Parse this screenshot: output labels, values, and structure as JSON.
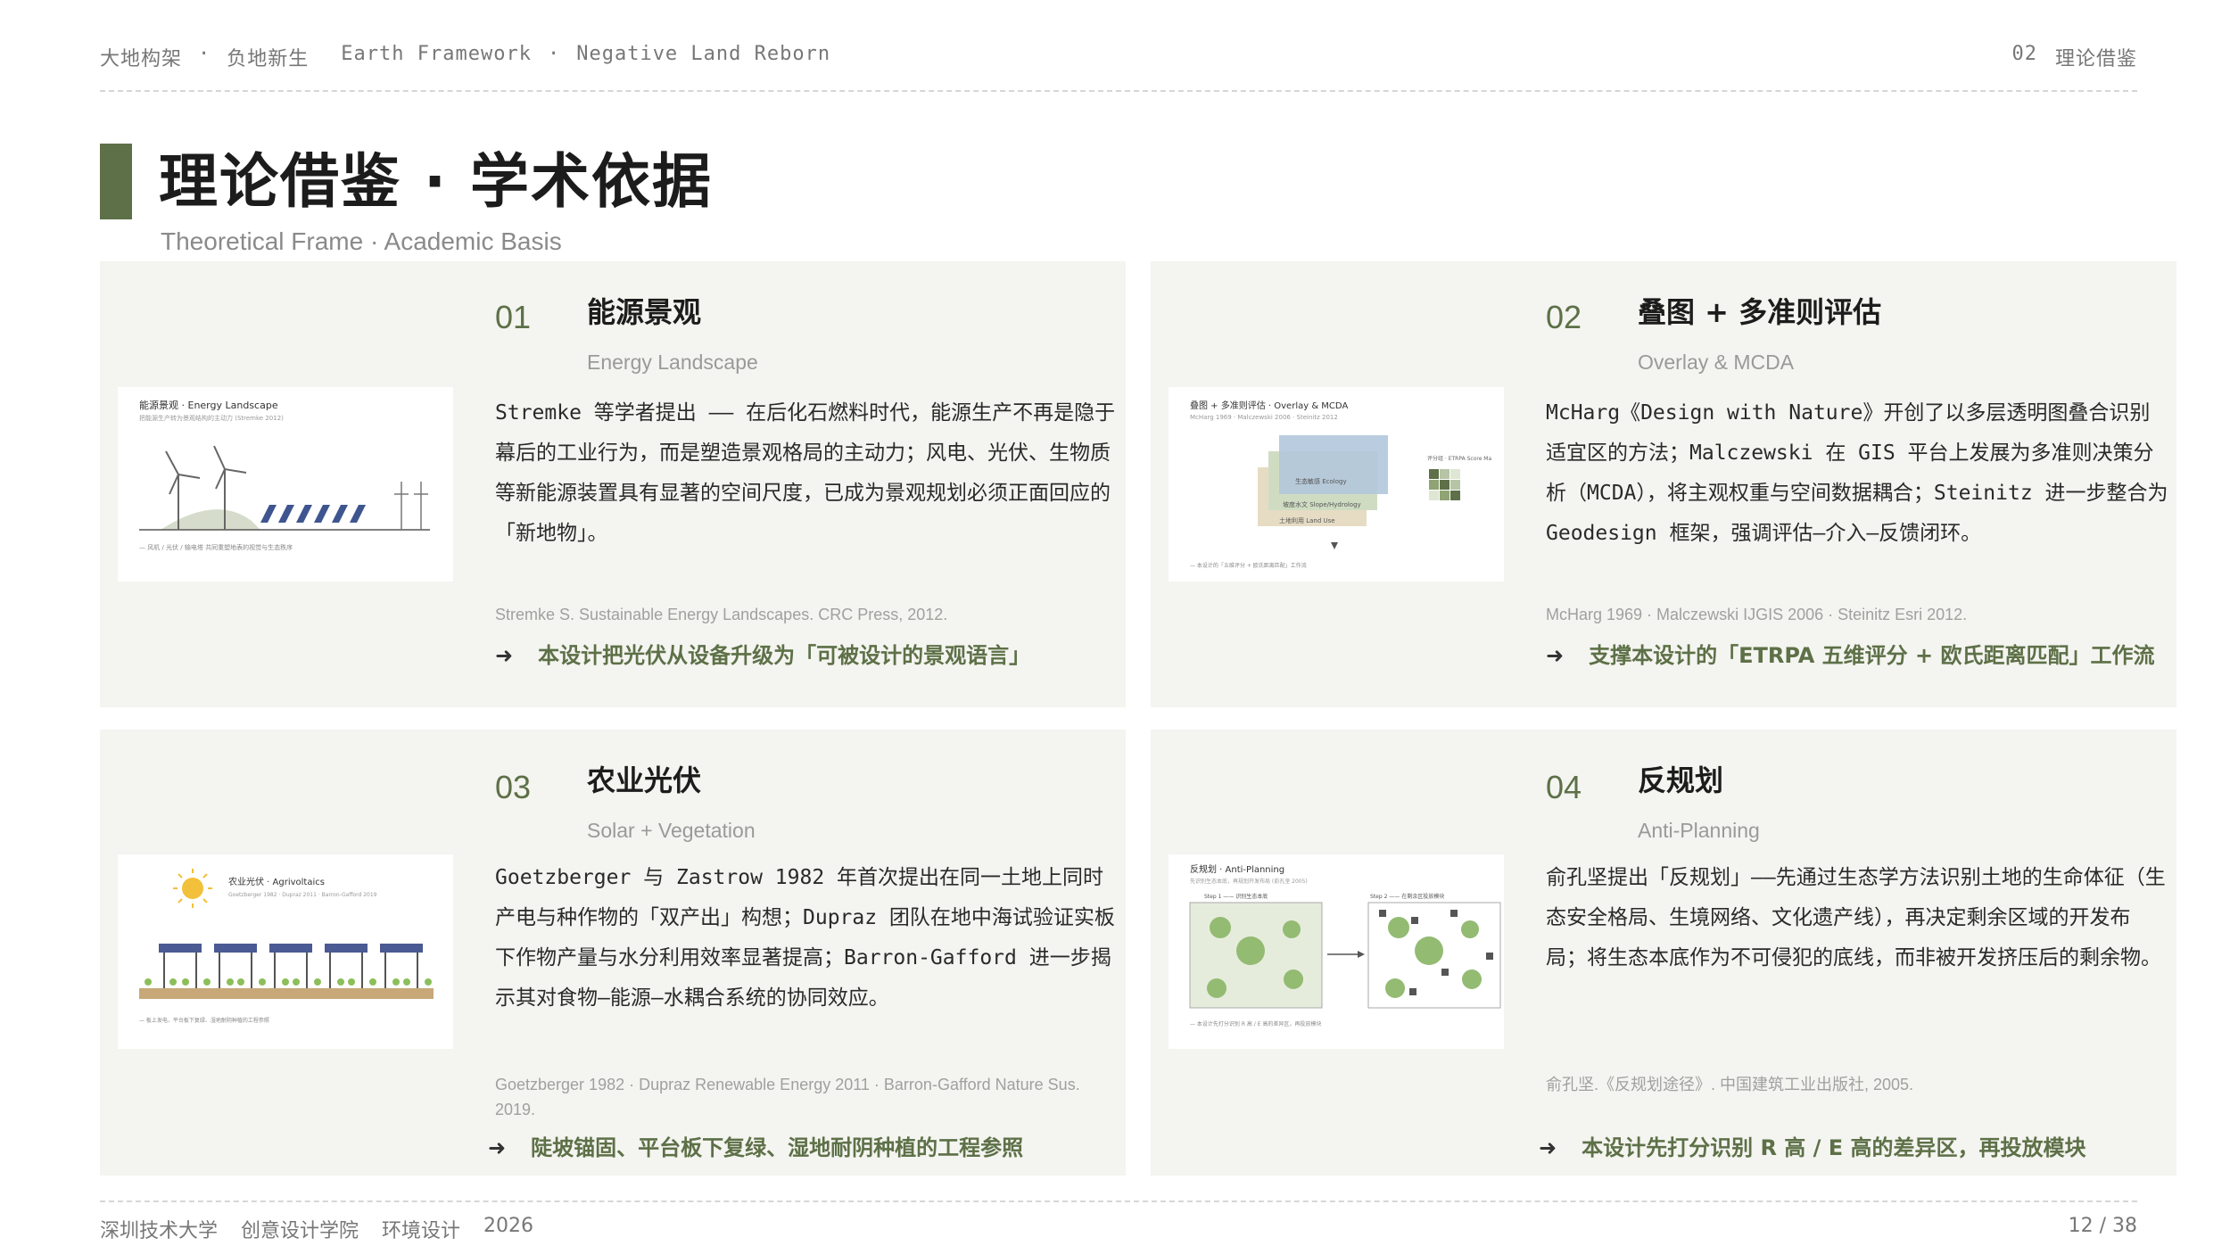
{
  "header": {
    "left_items": [
      "大地构架",
      "·",
      "负地新生",
      "Earth Framework",
      "·",
      "Negative Land Reborn"
    ],
    "section_num": "02",
    "section_name": "理论借鉴"
  },
  "page": {
    "title": "理论借鉴 · 学术依据",
    "subtitle": "Theoretical Frame · Academic Basis"
  },
  "accent_color": "#5d7047",
  "cards": [
    {
      "num": "01",
      "title": "能源景观",
      "subtitle": "Energy Landscape",
      "body": "Stremke 等学者提出 —— 在后化石燃料时代，能源生产不再是隐于幕后的工业行为，而是塑造景观格局的主动力；风电、光伏、生物质等新能源装置具有显著的空间尺度，已成为景观规划必须正面回应的「新地物」。",
      "ref": "Stremke S. Sustainable Energy Landscapes. CRC Press, 2012.",
      "takeaway": "本设计把光伏从设备升级为「可被设计的景观语言」",
      "thumb": {
        "title": "能源景观 · Energy Landscape",
        "note": "把能源生产转为景观结构的主动力 (Stremke 2012)",
        "caption": "— 风机 / 光伏 / 输电塔 共同重塑地表的视觉与生态秩序"
      }
    },
    {
      "num": "02",
      "title": "叠图 + 多准则评估",
      "subtitle": "Overlay & MCDA",
      "body": "McHarg《Design with Nature》开创了以多层透明图叠合识别适宜区的方法；Malczewski 在 GIS 平台上发展为多准则决策分析（MCDA），将主观权重与空间数据耦合；Steinitz 进一步整合为 Geodesign 框架，强调评估—介入—反馈闭环。",
      "ref": "McHarg 1969 · Malczewski IJGIS 2006 · Steinitz Esri 2012.",
      "takeaway": "支撑本设计的「ETRPA 五维评分 + 欧氏距离匹配」工作流",
      "thumb": {
        "title": "叠图 + 多准则评估 · Overlay & MCDA",
        "note": "McHarg 1969 · Malczewski 2006 · Steinitz 2012",
        "layer1": "生态敏感 Ecology",
        "layer2": "坡度水文 Slope/Hydrology",
        "layer3": "土地利用 Land Use",
        "score": "评分组 · ETRPA Score Ma",
        "caption": "— 本设计的「五维评分 + 欧氏距离匹配」工作流"
      }
    },
    {
      "num": "03",
      "title": "农业光伏",
      "subtitle": "Solar + Vegetation",
      "body": "Goetzberger 与 Zastrow 1982 年首次提出在同一土地上同时产电与种作物的「双产出」构想；Dupraz 团队在地中海试验证实板下作物产量与水分利用效率显著提高；Barron-Gafford 进一步揭示其对食物—能源—水耦合系统的协同效应。",
      "ref": "Goetzberger 1982 · Dupraz Renewable Energy 2011 · Barron-Gafford Nature Sus. 2019.",
      "takeaway": "陡坡锚固、平台板下复绿、湿地耐阴种植的工程参照",
      "thumb": {
        "title": "农业光伏 · Agrivoltaics",
        "note": "Goetzberger 1982 · Dupraz 2011 · Barron-Gafford 2019",
        "caption": "— 板上发电、平台板下复绿、湿地耐阴种植的工程参照"
      }
    },
    {
      "num": "04",
      "title": "反规划",
      "subtitle": "Anti-Planning",
      "body": "俞孔坚提出「反规划」——先通过生态学方法识别土地的生命体征（生态安全格局、生境网络、文化遗产线），再决定剩余区域的开发布局；将生态本底作为不可侵犯的底线，而非被开发挤压后的剩余物。",
      "ref": "俞孔坚.《反规划途径》. 中国建筑工业出版社, 2005.",
      "takeaway": "本设计先打分识别 R 高 / E 高的差异区，再投放模块",
      "thumb": {
        "title": "反规划 · Anti-Planning",
        "note": "先识别生态本底，再规划开发布局 (俞孔坚 2005)",
        "step1": "Step 1 —— 识别生态本底",
        "step2": "Step 2 —— 在剩余区投放模块",
        "caption": "— 本设计先打分识别 R 高 / E 高的差异区，再投放模块"
      }
    }
  ],
  "footer": {
    "items": [
      "深圳技术大学",
      "创意设计学院",
      "环境设计",
      "2026"
    ],
    "page": "12 / 38"
  }
}
